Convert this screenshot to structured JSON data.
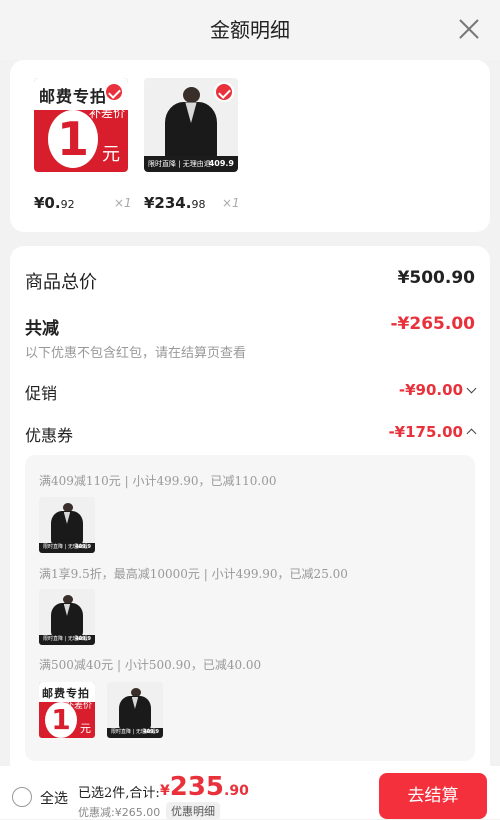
{
  "header": {
    "title": "金额明细"
  },
  "products": [
    {
      "band_text": "邮费专拍",
      "diff_text": "补差价",
      "big_num": "1",
      "unit": "元",
      "price_main": "¥0.",
      "price_dec": "92",
      "qty": "×1"
    },
    {
      "bar_text": "限时直降 | 无理由退",
      "bar_price": "409.9",
      "price_main": "¥234.",
      "price_dec": "98",
      "qty": "×1"
    }
  ],
  "summary": {
    "goods_total_label": "商品总价",
    "goods_total_value": "¥500.90",
    "total_discount_label": "共减",
    "total_discount_value": "-¥265.00",
    "discount_note": "以下优惠不包含红包，请在结算页查看",
    "promotion_label": "促销",
    "promotion_value": "-¥90.00",
    "coupon_label": "优惠券",
    "coupon_value": "-¥175.00"
  },
  "coupon_details": [
    {
      "text": "满409减110元 | 小计499.90，已减110.00"
    },
    {
      "text": "满1享9.5折，最高减10000元 | 小计499.90，已减25.00"
    },
    {
      "text": "满500减40元 | 小计500.90，已减40.00"
    }
  ],
  "mini_thumbs": {
    "post_band": "邮费专拍",
    "post_diff": "补差价",
    "post_num": "1",
    "post_unit": "元",
    "jacket_bar": "限时直降 | 无理由退",
    "jacket_price": "409.9"
  },
  "footer": {
    "select_all_label": "全选",
    "selected_text": "已选2件,合计:",
    "total_symbol": "¥",
    "total_integer": "235",
    "total_decimal": ".90",
    "discount_text": "优惠减:¥265.00",
    "detail_label": "优惠明细",
    "checkout_label": "去结算"
  },
  "colors": {
    "accent_red": "#e8313b",
    "checkout_bg": "#f4303d"
  }
}
